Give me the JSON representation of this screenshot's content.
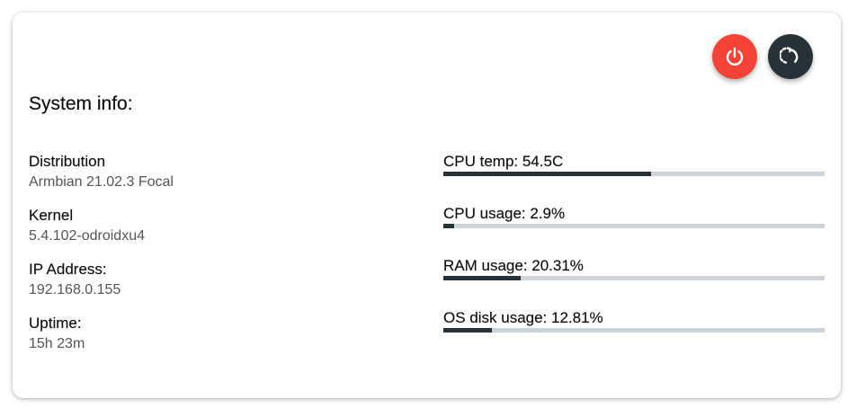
{
  "actions": {
    "power_color": "#f44336",
    "reboot_color": "#263238",
    "power_icon": "power-icon",
    "reboot_icon": "restart-icon"
  },
  "title": "System info:",
  "info": [
    {
      "label": "Distribution",
      "value": "Armbian 21.02.3 Focal"
    },
    {
      "label": "Kernel",
      "value": "5.4.102-odroidxu4"
    },
    {
      "label": "IP Address:",
      "value": "192.168.0.155"
    },
    {
      "label": "Uptime:",
      "value": "15h 23m"
    }
  ],
  "stats": [
    {
      "label": "CPU temp: 54.5C",
      "fraction": 0.545
    },
    {
      "label": "CPU usage: 2.9%",
      "fraction": 0.029
    },
    {
      "label": "RAM usage: 20.31%",
      "fraction": 0.2031
    },
    {
      "label": "OS disk usage: 12.81%",
      "fraction": 0.1281
    }
  ],
  "colors": {
    "bar_fill": "#263238",
    "bar_track": "#ccd3d9"
  }
}
